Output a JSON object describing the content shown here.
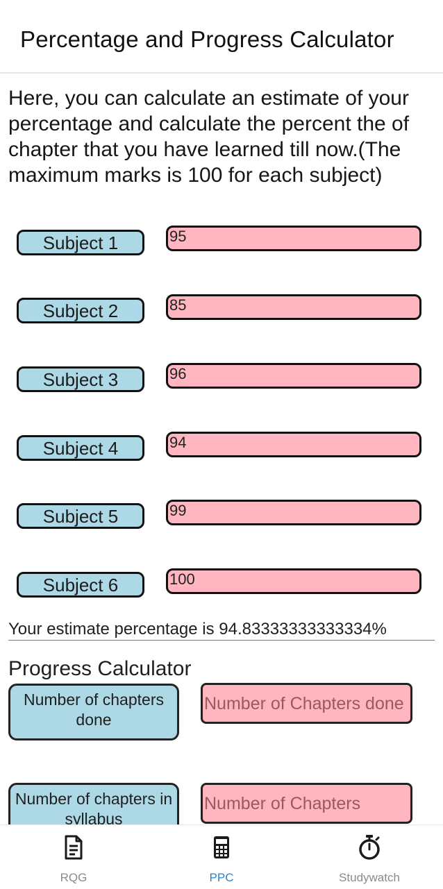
{
  "header": {
    "title": "Percentage and Progress Calculator"
  },
  "intro": "Here, you can calculate an estimate of your percentage and calculate the percent the of chapter that you have learned till now.(The maximum marks is 100 for each subject)",
  "subjects": [
    {
      "label": "Subject 1",
      "value": "95"
    },
    {
      "label": "Subject 2",
      "value": "85"
    },
    {
      "label": "Subject 3",
      "value": "96"
    },
    {
      "label": "Subject 4",
      "value": "94"
    },
    {
      "label": "Subject 5",
      "value": "99"
    },
    {
      "label": "Subject 6",
      "value": "100"
    }
  ],
  "result": "Your estimate percentage is 94.83333333333334%",
  "progress": {
    "title": "Progress Calculator",
    "chapters_done_label": "Number of chapters done",
    "chapters_done_placeholder": "Number of Chapters done",
    "chapters_total_label": "Number of chapters in syllabus",
    "chapters_total_placeholder": "Number of Chapters"
  },
  "nav": {
    "active": "PPC",
    "items": [
      {
        "label": "RQG",
        "icon": "document-icon"
      },
      {
        "label": "PPC",
        "icon": "calculator-icon"
      },
      {
        "label": "Studywatch",
        "icon": "stopwatch-icon"
      }
    ]
  },
  "colors": {
    "subject_button": "#add8e6",
    "input_bg": "#ffb6c1",
    "active_tab": "#2d82c7"
  }
}
